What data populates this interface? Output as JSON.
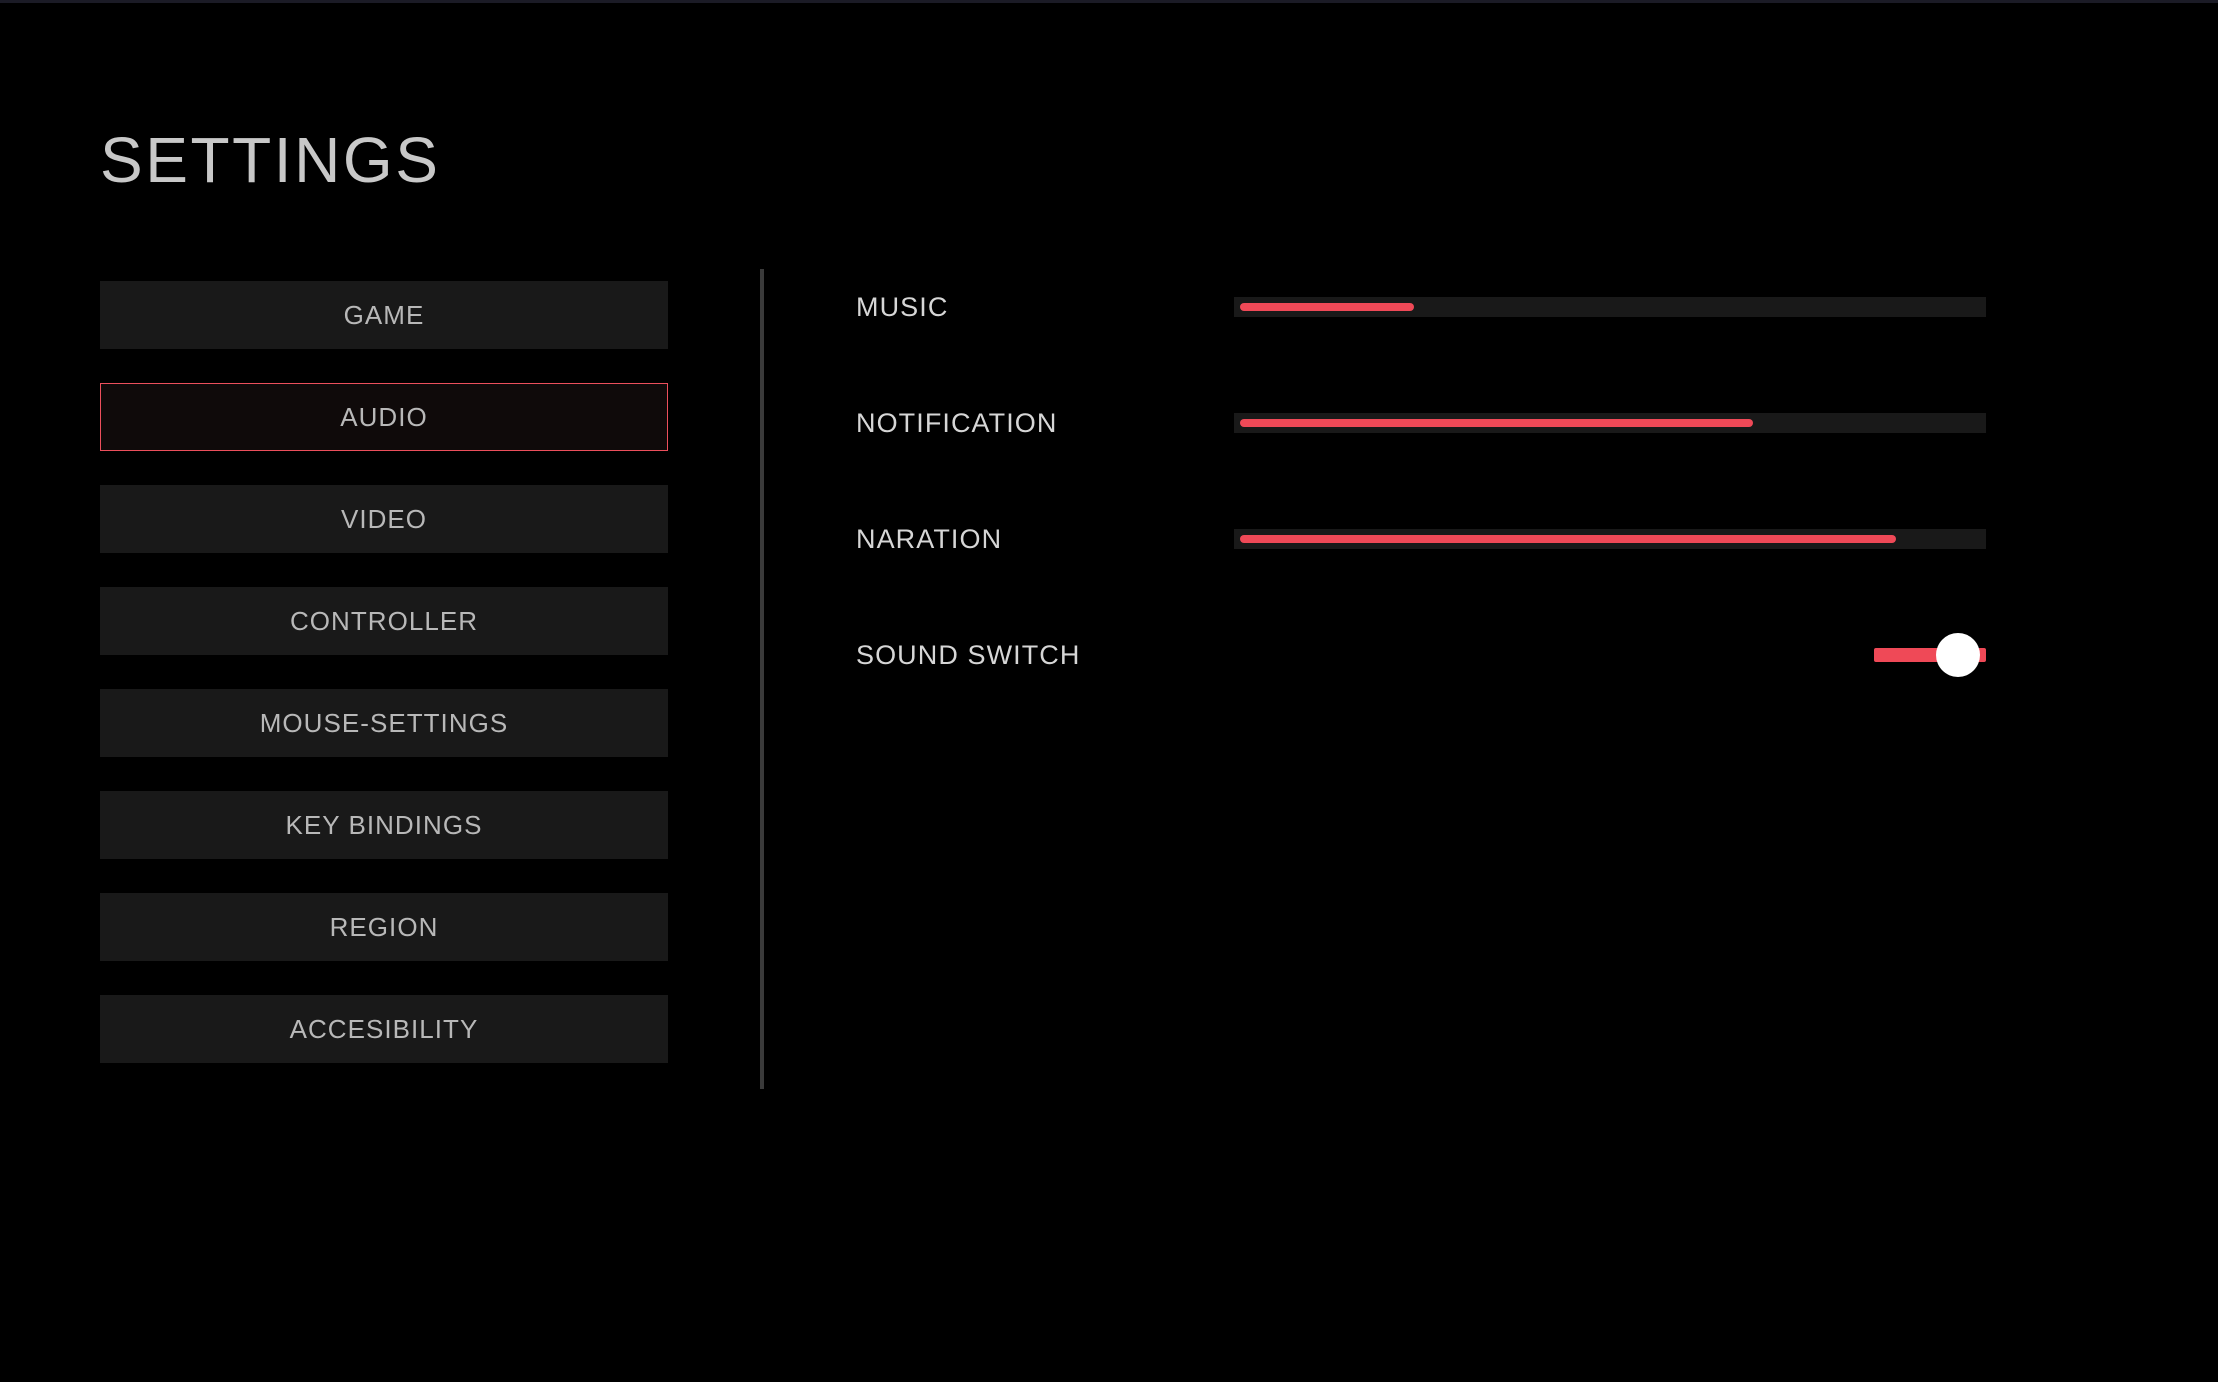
{
  "title": "SETTINGS",
  "sidebar": {
    "items": [
      {
        "label": "GAME",
        "active": false
      },
      {
        "label": "AUDIO",
        "active": true
      },
      {
        "label": "VIDEO",
        "active": false
      },
      {
        "label": "CONTROLLER",
        "active": false
      },
      {
        "label": "MOUSE-SETTINGS",
        "active": false
      },
      {
        "label": "KEY BINDINGS",
        "active": false
      },
      {
        "label": "REGION",
        "active": false
      },
      {
        "label": "ACCESIBILITY",
        "active": false
      }
    ]
  },
  "audio": {
    "sliders": [
      {
        "label": "MUSIC",
        "value": 24
      },
      {
        "label": "NOTIFICATION",
        "value": 69
      },
      {
        "label": "NARATION",
        "value": 88
      }
    ],
    "switch": {
      "label": "SOUND SWITCH",
      "on": true
    }
  },
  "colors": {
    "accent": "#ef4957",
    "panel": "#191919",
    "background": "#000000"
  }
}
